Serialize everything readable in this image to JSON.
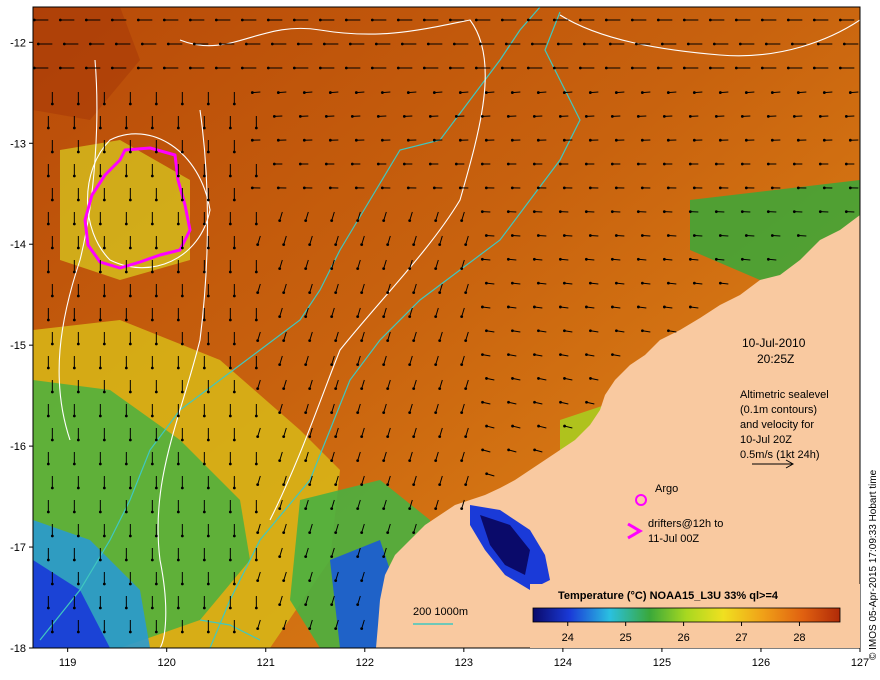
{
  "map": {
    "x_ticks": [
      "119",
      "120",
      "121",
      "122",
      "123",
      "124",
      "125",
      "126",
      "127"
    ],
    "y_ticks": [
      "-12",
      "-13",
      "-14",
      "-15",
      "-16",
      "-17",
      "-18"
    ],
    "colors": {
      "land": "#f9c9a0",
      "sea_warm": "#c0580a",
      "sea_cool": "#e89a1a",
      "green": "#3aa83a",
      "yellow": "#d8e020",
      "blue": "#1a3ad8",
      "navy": "#0a0a6a",
      "contour": "#ffffff",
      "isobath": "#40c8c0",
      "drifter": "#ff00ff"
    }
  },
  "annotations": {
    "date": "10-Jul-2010",
    "time": "20:25Z",
    "altimetry": [
      "Altimetric sealevel",
      "(0.1m contours)",
      "and velocity for",
      "10-Jul 20Z",
      "0.5m/s (1kt 24h)"
    ],
    "argo_label": "Argo",
    "drifters_line1": "drifters@12h to",
    "drifters_line2": "11-Jul 00Z",
    "isobath_label": "200  1000m"
  },
  "colorbar": {
    "title": "Temperature (°C) NOAA15_L3U 33% ql>=4",
    "ticks": [
      "24",
      "25",
      "26",
      "27",
      "28"
    ],
    "stops": [
      "#0a0a6a",
      "#1a3ad8",
      "#2ac0e0",
      "#3aa83a",
      "#a8d820",
      "#f0e020",
      "#f0a018",
      "#e06010",
      "#b02a08"
    ]
  },
  "credit": "© IMOS 05-Apr-2015 17:09:33 Hobart time"
}
